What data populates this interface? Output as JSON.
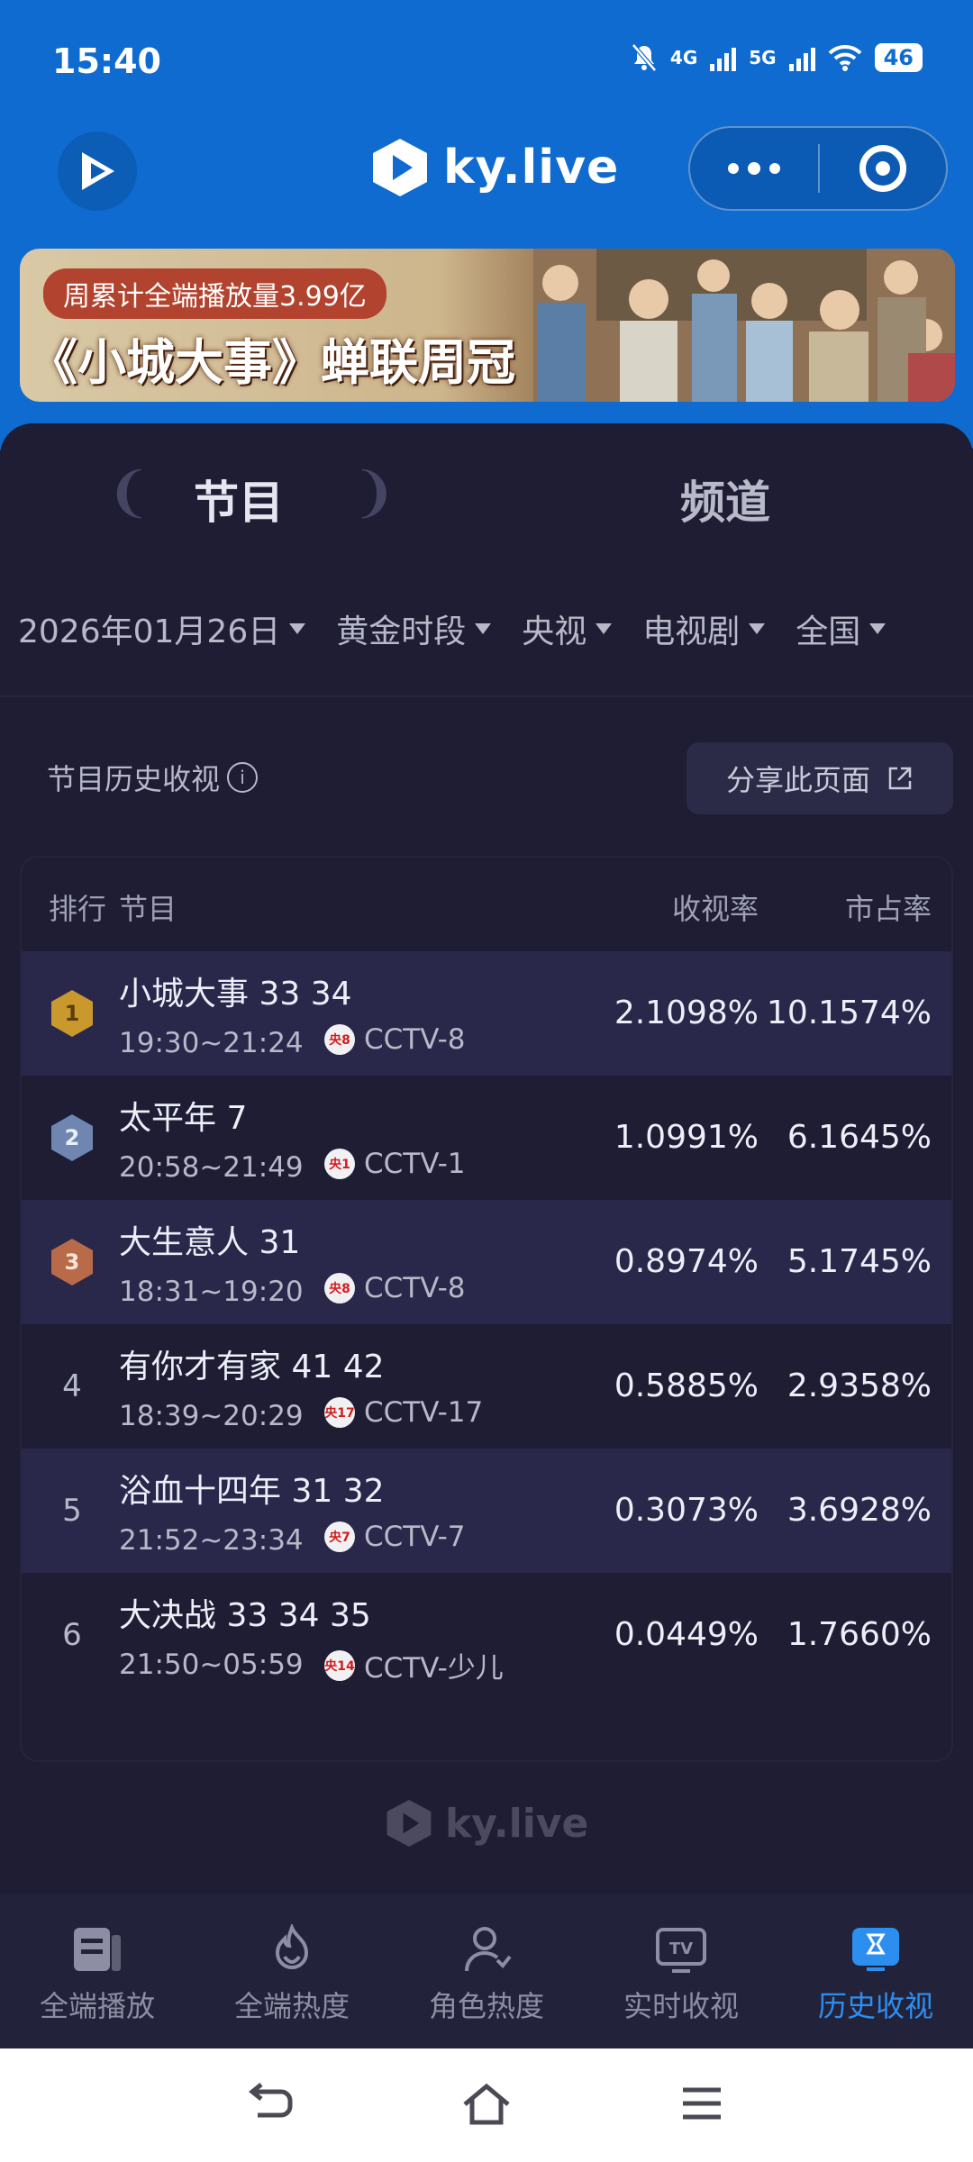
{
  "status_bar": {
    "time": "15:40",
    "net1": "4G",
    "net2": "5G",
    "battery": "46"
  },
  "header": {
    "logo_text": "ky.live"
  },
  "banner": {
    "tag": "周累计全端播放量3.99亿",
    "title": "《小城大事》蝉联周冠"
  },
  "tabs": [
    {
      "label": "节目"
    },
    {
      "label": "频道"
    }
  ],
  "filters": [
    {
      "label": "2026年01月26日"
    },
    {
      "label": "黄金时段"
    },
    {
      "label": "央视"
    },
    {
      "label": "电视剧"
    },
    {
      "label": "全国"
    }
  ],
  "history": {
    "title": "节目历史收视",
    "share_label": "分享此页面"
  },
  "table": {
    "headers": {
      "rank": "排行",
      "program": "节目",
      "rating": "收视率",
      "share": "市占率"
    },
    "rows": [
      {
        "rank": "1",
        "name": "小城大事 33 34",
        "time": "19:30~21:24",
        "channel_badge": "央8",
        "channel": "CCTV-8",
        "rating": "2.1098%",
        "share": "10.1574%"
      },
      {
        "rank": "2",
        "name": "太平年 7",
        "time": "20:58~21:49",
        "channel_badge": "央1",
        "channel": "CCTV-1",
        "rating": "1.0991%",
        "share": "6.1645%"
      },
      {
        "rank": "3",
        "name": "大生意人 31",
        "time": "18:31~19:20",
        "channel_badge": "央8",
        "channel": "CCTV-8",
        "rating": "0.8974%",
        "share": "5.1745%"
      },
      {
        "rank": "4",
        "name": "有你才有家 41 42",
        "time": "18:39~20:29",
        "channel_badge": "央17",
        "channel": "CCTV-17",
        "rating": "0.5885%",
        "share": "2.9358%"
      },
      {
        "rank": "5",
        "name": "浴血十四年 31 32",
        "time": "21:52~23:34",
        "channel_badge": "央7",
        "channel": "CCTV-7",
        "rating": "0.3073%",
        "share": "3.6928%"
      },
      {
        "rank": "6",
        "name": "大决战 33 34 35",
        "time": "21:50~05:59",
        "channel_badge": "央14",
        "channel": "CCTV-少儿",
        "rating": "0.0449%",
        "share": "1.7660%"
      }
    ]
  },
  "footer": {
    "logo_text": "ky.live"
  },
  "bottom_nav": [
    {
      "label": "全端播放",
      "icon": "playlist-icon"
    },
    {
      "label": "全端热度",
      "icon": "flame-icon"
    },
    {
      "label": "角色热度",
      "icon": "person-icon"
    },
    {
      "label": "实时收视",
      "icon": "tv-icon"
    },
    {
      "label": "历史收视",
      "icon": "hourglass-icon",
      "active": true
    }
  ],
  "colors": {
    "brand_blue": "#0f6bcf",
    "active_nav": "#2c8ff0",
    "background": "#1d1c33"
  }
}
